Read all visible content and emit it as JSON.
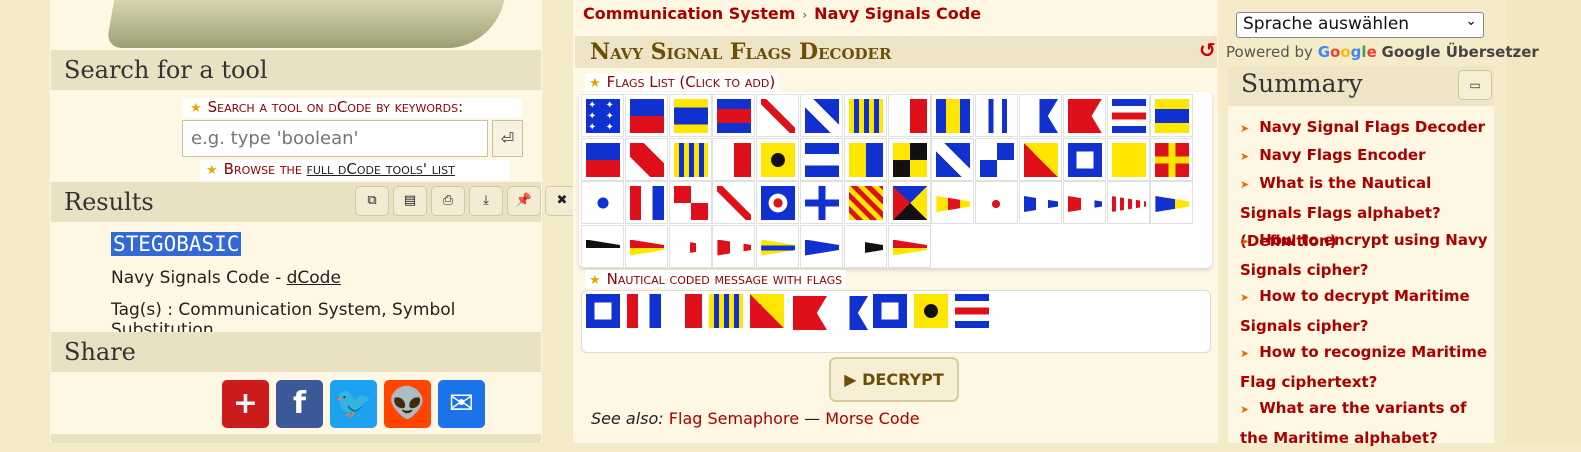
{
  "left": {
    "search_title": "Search for a tool",
    "search_label": "Search a tool on dCode by keywords:",
    "search_placeholder": "e.g. type 'boolean'",
    "search_submit": "⏎",
    "browse_prefix": "Browse the ",
    "browse_link": "full dCode tools' list",
    "results_title": "Results",
    "result_tools": [
      "copy-icon",
      "save-icon",
      "print-icon",
      "download-icon",
      "pin-icon",
      "close-icon"
    ],
    "result_value": "STEGOBASIC",
    "result_source_prefix": "Navy Signals Code - ",
    "result_source_link": "dCode",
    "tags": "Tag(s) : Communication System, Symbol Substitution",
    "share_title": "Share",
    "share_buttons": [
      {
        "name": "share-plus-button",
        "glyph": "+",
        "color": "#cc1b1b"
      },
      {
        "name": "share-facebook-button",
        "glyph": "f",
        "color": "#3b5998"
      },
      {
        "name": "share-twitter-button",
        "glyph": "🐦",
        "color": "#1da1f2"
      },
      {
        "name": "share-reddit-button",
        "glyph": "👽",
        "color": "#ff4500"
      },
      {
        "name": "share-email-button",
        "glyph": "✉",
        "color": "#1a73e8"
      }
    ]
  },
  "center": {
    "breadcrumb": [
      "Communication System",
      "Navy Signals Code"
    ],
    "breadcrumb_sep": "›",
    "title": "Navy Signal Flags Decoder",
    "flags_label": "Flags List (Click to add)",
    "message_label": "Nautical coded message with flags",
    "decrypt_label": "▶ DECRYPT",
    "see_also_label": "See also:",
    "see_also_links": [
      "Flag Semaphore",
      "Morse Code"
    ],
    "see_also_sep": " — ",
    "flag_rows": 4,
    "message_flags": [
      "P",
      "T",
      "H",
      "G",
      "Y",
      "B",
      "A",
      "P",
      "I",
      "C"
    ]
  },
  "right": {
    "language_select": "Sprache auswählen",
    "powered_by": "Powered by ",
    "google": "Google",
    "translate": "Google Übersetzer",
    "summary_title": "Summary",
    "summary_items": [
      "Navy Signal Flags Decoder",
      "Navy Flags Encoder",
      "What is the Nautical Signals Flags alphabet? (Definition)",
      "How to encrypt using Navy Signals cipher?",
      "How to decrypt Maritime Signals cipher?",
      "How to recognize Maritime Flag ciphertext?",
      "What are the variants of the Maritime alphabet?"
    ]
  },
  "colors": {
    "page_bg": "#f6ebc9",
    "panel_bg": "#fdf7e3",
    "link_red": "#aa0000",
    "result_highlight": "#3369d6"
  }
}
